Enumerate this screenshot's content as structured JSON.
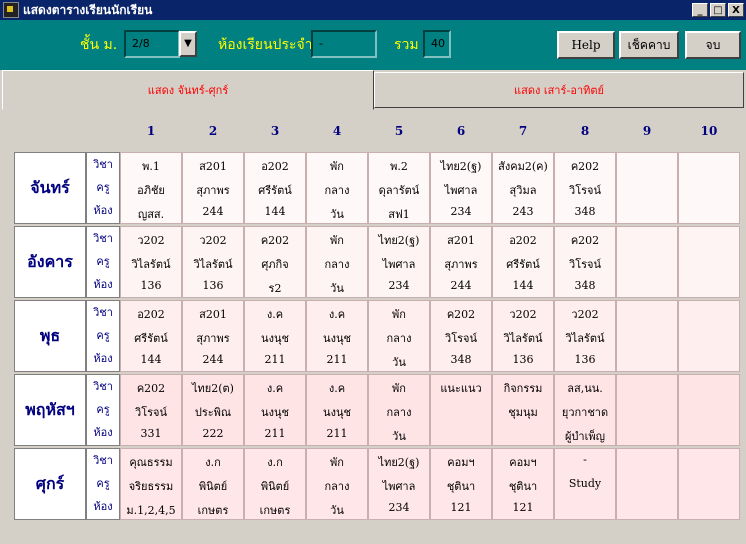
{
  "window": {
    "title": "แสดงตารางเรียนนักเรียน",
    "controls": [
      "_",
      "□",
      "X"
    ]
  },
  "toolbar": {
    "grade_label": "ชั้น ม.",
    "grade_value": "2/8",
    "homeroom_label": "ห้องเรียนประจำ",
    "homeroom_value": "-",
    "total_label": "รวม",
    "total_value": "40",
    "help_label": "Help",
    "check_label": "เช็คคาบ",
    "exit_label": "จบ"
  },
  "tabs": {
    "weekday": "แสดง จันทร์-ศุกร์",
    "weekend": "แสดง เสาร์-อาทิตย์"
  },
  "periods": [
    "1",
    "2",
    "3",
    "4",
    "5",
    "6",
    "7",
    "8",
    "9",
    "10"
  ],
  "row_labels": {
    "subject": "วิชา",
    "teacher": "ครู",
    "room": "ห้อง"
  },
  "colors": {
    "title_bg": "#0a246a",
    "toolbar_bg": "#008080",
    "label": "#ffff00",
    "tab_text": "#ff0000",
    "day_text": "#000080"
  },
  "days": [
    {
      "name": "จันทร์",
      "cells": [
        [
          "พ.1",
          "อภิชัย",
          "ญสส."
        ],
        [
          "ส201",
          "สุภาพร",
          "244"
        ],
        [
          "อ202",
          "ศรีรัตน์",
          "144"
        ],
        [
          "พัก",
          "กลาง",
          "วัน"
        ],
        [
          "พ.2",
          "ดุลารัตน์",
          "สฟ1"
        ],
        [
          "ไทย2(ฐ)",
          "ไพศาล",
          "234"
        ],
        [
          "สังคม2(ค)",
          "สุวิมล",
          "243"
        ],
        [
          "ค202",
          "วิโรจน์",
          "348"
        ],
        [
          "",
          "",
          ""
        ],
        [
          "",
          "",
          ""
        ]
      ]
    },
    {
      "name": "อังคาร",
      "cells": [
        [
          "ว202",
          "วิไลรัตน์",
          "136"
        ],
        [
          "ว202",
          "วิไลรัตน์",
          "136"
        ],
        [
          "ค202",
          "ศุภกิจ",
          "ร2"
        ],
        [
          "พัก",
          "กลาง",
          "วัน"
        ],
        [
          "ไทย2(ฐ)",
          "ไพศาล",
          "234"
        ],
        [
          "ส201",
          "สุภาพร",
          "244"
        ],
        [
          "อ202",
          "ศรีรัตน์",
          "144"
        ],
        [
          "ค202",
          "วิโรจน์",
          "348"
        ],
        [
          "",
          "",
          ""
        ],
        [
          "",
          "",
          ""
        ]
      ]
    },
    {
      "name": "พุธ",
      "cells": [
        [
          "อ202",
          "ศรีรัตน์",
          "144"
        ],
        [
          "ส201",
          "สุภาพร",
          "244"
        ],
        [
          "ง.ค",
          "นงนุช",
          "211"
        ],
        [
          "ง.ค",
          "นงนุช",
          "211"
        ],
        [
          "พัก",
          "กลาง",
          "วัน"
        ],
        [
          "ค202",
          "วิโรจน์",
          "348"
        ],
        [
          "ว202",
          "วิไลรัตน์",
          "136"
        ],
        [
          "ว202",
          "วิไลรัตน์",
          "136"
        ],
        [
          "",
          "",
          ""
        ],
        [
          "",
          "",
          ""
        ]
      ]
    },
    {
      "name": "พฤหัสฯ",
      "cells": [
        [
          "ค202",
          "วิโรจน์",
          "331"
        ],
        [
          "ไทย2(ต)",
          "ประพิณ",
          "222"
        ],
        [
          "ง.ค",
          "นงนุช",
          "211"
        ],
        [
          "ง.ค",
          "นงนุช",
          "211"
        ],
        [
          "พัก",
          "กลาง",
          "วัน"
        ],
        [
          "แนะแนว",
          "",
          ""
        ],
        [
          "กิจกรรม",
          "ชุมนุม",
          ""
        ],
        [
          "ลส,นน.",
          "ยุวกาชาด",
          "ผู้บำเพ็ญ"
        ],
        [
          "",
          "",
          ""
        ],
        [
          "",
          "",
          ""
        ]
      ]
    },
    {
      "name": "ศุกร์",
      "cells": [
        [
          "คุณธรรม",
          "จริยธรรม",
          "ม.1,2,4,5"
        ],
        [
          "ง.ก",
          "พินิตย์",
          "เกษตร"
        ],
        [
          "ง.ก",
          "พินิตย์",
          "เกษตร"
        ],
        [
          "พัก",
          "กลาง",
          "วัน"
        ],
        [
          "ไทย2(ฐ)",
          "ไพศาล",
          "234"
        ],
        [
          "คอมฯ",
          "ชุตินา",
          "121"
        ],
        [
          "คอมฯ",
          "ชุตินา",
          "121"
        ],
        [
          "-",
          "Study",
          ""
        ],
        [
          "",
          "",
          ""
        ],
        [
          "",
          "",
          ""
        ]
      ]
    }
  ]
}
